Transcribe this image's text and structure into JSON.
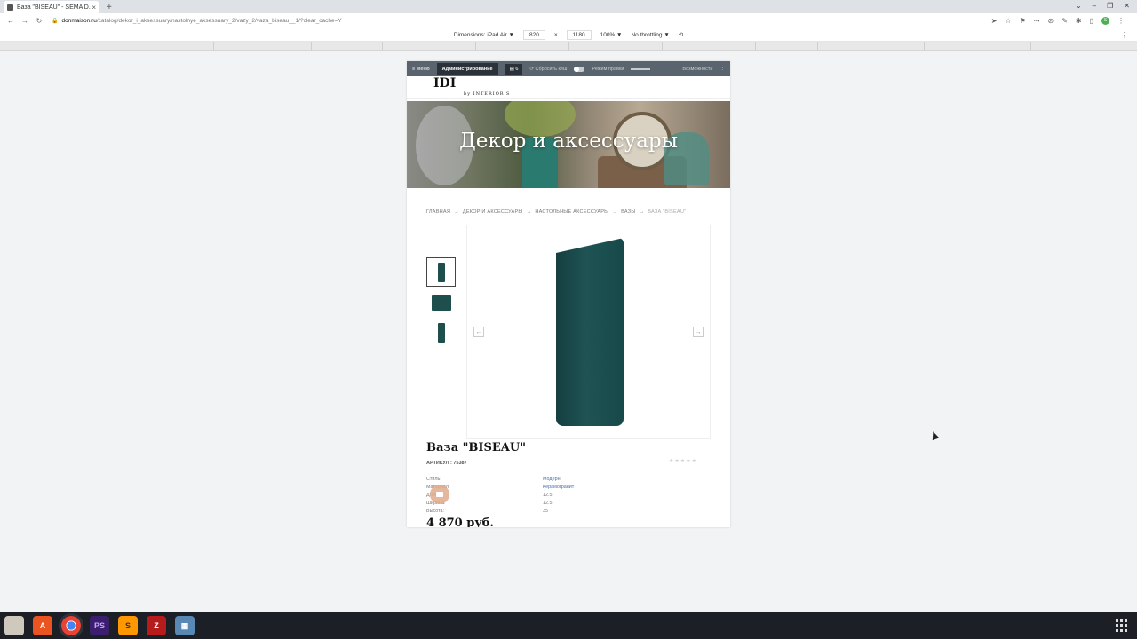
{
  "browser": {
    "tab_title": "Ваза \"BISEAU\" - SEMA D...",
    "url_host": "donmaison.ru",
    "url_path": "/catalog/dekor_i_aksessuary/nastolnye_aksessuary_2/vazy_2/vaza_biseau__1/?clear_cache=Y",
    "new_tab": "+",
    "close_tab": "×"
  },
  "devtools": {
    "dimensions_label": "Dimensions: iPad Air ▼",
    "width": "820",
    "times": "×",
    "height": "1180",
    "zoom": "100% ▼",
    "throttling": "No throttling ▼"
  },
  "adminbar": {
    "menu": "≡  Меню",
    "admin": "Администрирование",
    "count": "6",
    "clear_cache": "Сбросить кеш",
    "mode": "Режим правки",
    "capabilities": "Возможности"
  },
  "site": {
    "logo": "IDI",
    "logo_sub": "by INTERIOR'S",
    "hero_title": "Декор и аксессуары"
  },
  "breadcrumbs": [
    {
      "label": "ГЛАВНАЯ"
    },
    {
      "label": "ДЕКОР И АКСЕССУАРЫ"
    },
    {
      "label": "НАСТОЛЬНЫЕ АКСЕССУАРЫ"
    },
    {
      "label": "ВАЗЫ"
    },
    {
      "label": "ВАЗА \"BISEAU\""
    }
  ],
  "breadcrumb_sep": "→",
  "product": {
    "title": "Ваза \"BISEAU\"",
    "sku": "АРТИКУЛ : 75387",
    "stars": "★★★★★",
    "price": "4 870 руб.",
    "specs": [
      {
        "key": "Стиль:",
        "value": "Модерн"
      },
      {
        "key": "Материал:",
        "value": "Керамогранит"
      },
      {
        "key": "Длина:",
        "value": "12.5"
      },
      {
        "key": "Ширина:",
        "value": "12.5"
      },
      {
        "key": "Высота:",
        "value": "35"
      }
    ]
  },
  "gallery": {
    "prev": "←",
    "next": "→"
  },
  "colors": {
    "vase": "#1f5354",
    "adminbar": "#5a646f",
    "link": "#4a6fa5"
  }
}
